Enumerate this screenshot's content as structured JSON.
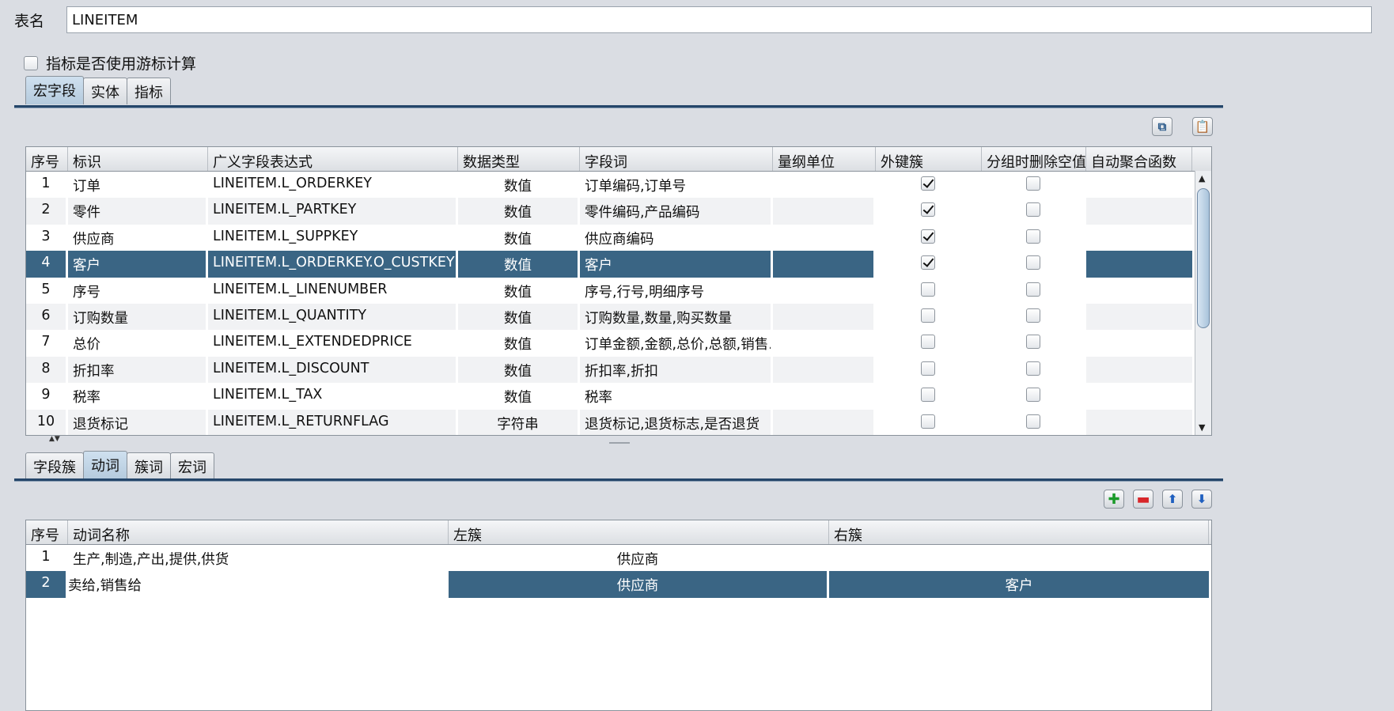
{
  "table_name": {
    "label": "表名",
    "value": "LINEITEM"
  },
  "cursor_option": {
    "label": "指标是否使用游标计算",
    "checked": false
  },
  "top_tabs": [
    {
      "label": "宏字段",
      "active": true
    },
    {
      "label": "实体",
      "active": false
    },
    {
      "label": "指标",
      "active": false
    }
  ],
  "top_toolbar": {
    "copy_icon": "copy-icon",
    "paste_icon": "paste-icon"
  },
  "fields_table": {
    "columns": [
      "序号",
      "标识",
      "广义字段表达式",
      "数据类型",
      "字段词",
      "量纲单位",
      "外键簇",
      "分组时删除空值",
      "自动聚合函数"
    ],
    "rows": [
      {
        "no": "1",
        "id": "订单",
        "expr": "LINEITEM.L_ORDERKEY",
        "type": "数值",
        "words": "订单编码,订单号",
        "unit": "",
        "fk": true,
        "del_null": false,
        "agg": ""
      },
      {
        "no": "2",
        "id": "零件",
        "expr": "LINEITEM.L_PARTKEY",
        "type": "数值",
        "words": "零件编码,产品编码",
        "unit": "",
        "fk": true,
        "del_null": false,
        "agg": ""
      },
      {
        "no": "3",
        "id": "供应商",
        "expr": "LINEITEM.L_SUPPKEY",
        "type": "数值",
        "words": "供应商编码",
        "unit": "",
        "fk": true,
        "del_null": false,
        "agg": ""
      },
      {
        "no": "4",
        "id": "客户",
        "expr": "LINEITEM.L_ORDERKEY.O_CUSTKEY",
        "type": "数值",
        "words": "客户",
        "unit": "",
        "fk": true,
        "del_null": false,
        "agg": "",
        "selected": true
      },
      {
        "no": "5",
        "id": "序号",
        "expr": "LINEITEM.L_LINENUMBER",
        "type": "数值",
        "words": "序号,行号,明细序号",
        "unit": "",
        "fk": false,
        "del_null": false,
        "agg": ""
      },
      {
        "no": "6",
        "id": "订购数量",
        "expr": "LINEITEM.L_QUANTITY",
        "type": "数值",
        "words": "订购数量,数量,购买数量",
        "unit": "",
        "fk": false,
        "del_null": false,
        "agg": ""
      },
      {
        "no": "7",
        "id": "总价",
        "expr": "LINEITEM.L_EXTENDEDPRICE",
        "type": "数值",
        "words": "订单金额,金额,总价,总额,销售...",
        "unit": "",
        "fk": false,
        "del_null": false,
        "agg": ""
      },
      {
        "no": "8",
        "id": "折扣率",
        "expr": "LINEITEM.L_DISCOUNT",
        "type": "数值",
        "words": "折扣率,折扣",
        "unit": "",
        "fk": false,
        "del_null": false,
        "agg": ""
      },
      {
        "no": "9",
        "id": "税率",
        "expr": "LINEITEM.L_TAX",
        "type": "数值",
        "words": "税率",
        "unit": "",
        "fk": false,
        "del_null": false,
        "agg": ""
      },
      {
        "no": "10",
        "id": "退货标记",
        "expr": "LINEITEM.L_RETURNFLAG",
        "type": "字符串",
        "words": "退货标记,退货标志,是否退货",
        "unit": "",
        "fk": false,
        "del_null": false,
        "agg": ""
      }
    ]
  },
  "bottom_tabs": [
    {
      "label": "字段簇",
      "active": false
    },
    {
      "label": "动词",
      "active": true
    },
    {
      "label": "簇词",
      "active": false
    },
    {
      "label": "宏词",
      "active": false
    }
  ],
  "bottom_toolbar": {
    "add_icon": "plus-icon",
    "remove_icon": "minus-icon",
    "up_icon": "arrow-up-icon",
    "down_icon": "arrow-down-icon"
  },
  "verbs_table": {
    "columns": [
      "序号",
      "动词名称",
      "左簇",
      "右簇"
    ],
    "rows": [
      {
        "no": "1",
        "name": "生产,制造,产出,提供,供货",
        "left": "供应商",
        "right": ""
      },
      {
        "no": "2",
        "name": "卖给,销售给",
        "left": "供应商",
        "right": "客户",
        "selected": true
      }
    ]
  },
  "colors": {
    "selection": "#3a6584",
    "tab_line": "#25466a",
    "background": "#dadde3"
  }
}
